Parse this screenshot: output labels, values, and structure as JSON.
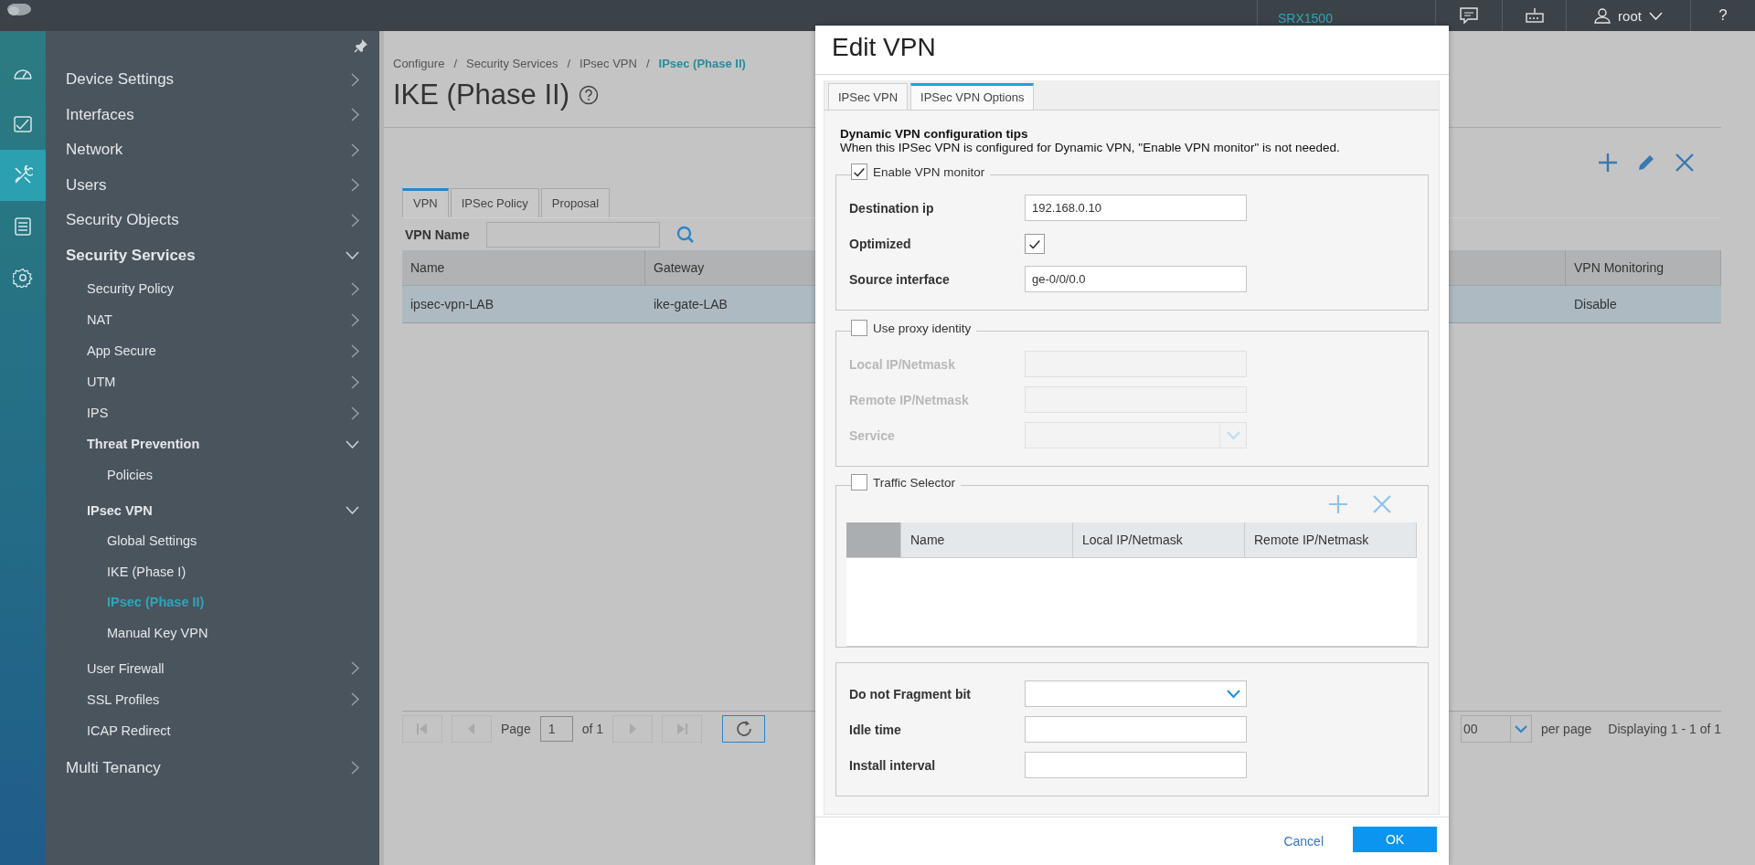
{
  "topbar": {
    "device": "SRX1500",
    "user": "root",
    "help": "?"
  },
  "sidebar": {
    "rail": [
      {
        "kind": "gauge",
        "selected": false
      },
      {
        "kind": "chart",
        "selected": false
      },
      {
        "kind": "tools",
        "selected": true
      },
      {
        "kind": "document",
        "selected": false
      },
      {
        "kind": "gear",
        "selected": false
      }
    ],
    "items": [
      {
        "label": "Device Settings",
        "expanded": false,
        "selected": false
      },
      {
        "label": "Interfaces",
        "expanded": false,
        "selected": false
      },
      {
        "label": "Network",
        "expanded": false,
        "selected": false
      },
      {
        "label": "Users",
        "expanded": false,
        "selected": false
      },
      {
        "label": "Security Objects",
        "expanded": false,
        "selected": false
      },
      {
        "label": "Security Services",
        "expanded": true,
        "selected": false,
        "children": [
          {
            "label": "Security Policy",
            "expanded": false,
            "selected": false
          },
          {
            "label": "NAT",
            "expanded": false,
            "selected": false
          },
          {
            "label": "App Secure",
            "expanded": false,
            "selected": false
          },
          {
            "label": "UTM",
            "expanded": false,
            "selected": false
          },
          {
            "label": "IPS",
            "expanded": false,
            "selected": false
          },
          {
            "label": "Threat Prevention",
            "expanded": true,
            "selected": false,
            "children": [
              {
                "label": "Policies",
                "selected": false
              }
            ]
          },
          {
            "label": "IPsec VPN",
            "expanded": true,
            "selected": false,
            "children": [
              {
                "label": "Global Settings",
                "selected": false
              },
              {
                "label": "IKE (Phase I)",
                "selected": false
              },
              {
                "label": "IPsec (Phase II)",
                "selected": true
              },
              {
                "label": "Manual Key VPN",
                "selected": false
              }
            ]
          },
          {
            "label": "User Firewall",
            "expanded": false,
            "selected": false
          },
          {
            "label": "SSL Profiles",
            "expanded": false,
            "selected": false
          },
          {
            "label": "ICAP Redirect",
            "selected": false
          }
        ]
      },
      {
        "label": "Multi Tenancy",
        "expanded": false,
        "selected": false
      }
    ]
  },
  "main": {
    "breadcrumb": [
      {
        "label": "Configure",
        "current": false
      },
      {
        "separator": "/",
        "label": "Security Services",
        "current": false
      },
      {
        "separator": "/",
        "label": "IPsec VPN",
        "current": false
      },
      {
        "separator": "/",
        "label": "IPsec (Phase II)",
        "current": true
      }
    ],
    "title": "IKE (Phase II)",
    "tabs": [
      {
        "label": "VPN",
        "selected": true
      },
      {
        "label": "IPSec Policy",
        "selected": false
      },
      {
        "label": "Proposal",
        "selected": false
      }
    ],
    "search": {
      "label": "VPN Name"
    },
    "table": {
      "columns": [
        "Name",
        "Gateway",
        "VPN Monitoring"
      ],
      "rows": [
        {
          "selected": true,
          "cells": [
            "ipsec-vpn-LAB",
            "ike-gate-LAB",
            "Disable"
          ]
        }
      ]
    },
    "pagination": {
      "page_label": "Page",
      "page": "1",
      "of": "of 1",
      "page_size": "00",
      "per_page": "per page",
      "summary": "Displaying 1 - 1 of 1"
    }
  },
  "modal": {
    "title": "Edit VPN",
    "tabs": [
      {
        "label": "IPSec VPN",
        "selected": false
      },
      {
        "label": "IPSec VPN Options",
        "selected": true
      }
    ],
    "tips": {
      "heading": "Dynamic VPN configuration tips",
      "text": "When this IPSec VPN is configured for Dynamic VPN, \"Enable VPN monitor\" is not needed."
    },
    "sections": [
      {
        "kind": "form",
        "legend": "Enable VPN monitor",
        "checked": true,
        "fields": [
          {
            "kind": "text",
            "label": "Destination ip",
            "value": "192.168.0.10",
            "disabled": false
          },
          {
            "kind": "checkbox",
            "label": "Optimized",
            "checked": true,
            "disabled": false
          },
          {
            "kind": "text",
            "label": "Source interface",
            "value": "ge-0/0/0.0",
            "disabled": false
          }
        ]
      },
      {
        "kind": "form",
        "legend": "Use proxy identity",
        "checked": false,
        "fields": [
          {
            "kind": "text",
            "label": "Local IP/Netmask",
            "disabled": true
          },
          {
            "kind": "text",
            "label": "Remote IP/Netmask",
            "disabled": true
          },
          {
            "kind": "select",
            "label": "Service",
            "disabled": true
          }
        ]
      },
      {
        "kind": "grid",
        "legend": "Traffic Selector",
        "checked": false,
        "columns": [
          "Name",
          "Local IP/Netmask",
          "Remote IP/Netmask"
        ]
      },
      {
        "kind": "form",
        "fields": [
          {
            "kind": "select",
            "label": "Do not Fragment bit",
            "disabled": false
          },
          {
            "kind": "text",
            "label": "Idle time",
            "disabled": false
          },
          {
            "kind": "text",
            "label": "Install interval",
            "disabled": false
          }
        ]
      }
    ],
    "buttons": [
      {
        "label": "Cancel",
        "kind": "link"
      },
      {
        "label": "OK",
        "kind": "primary"
      }
    ]
  }
}
